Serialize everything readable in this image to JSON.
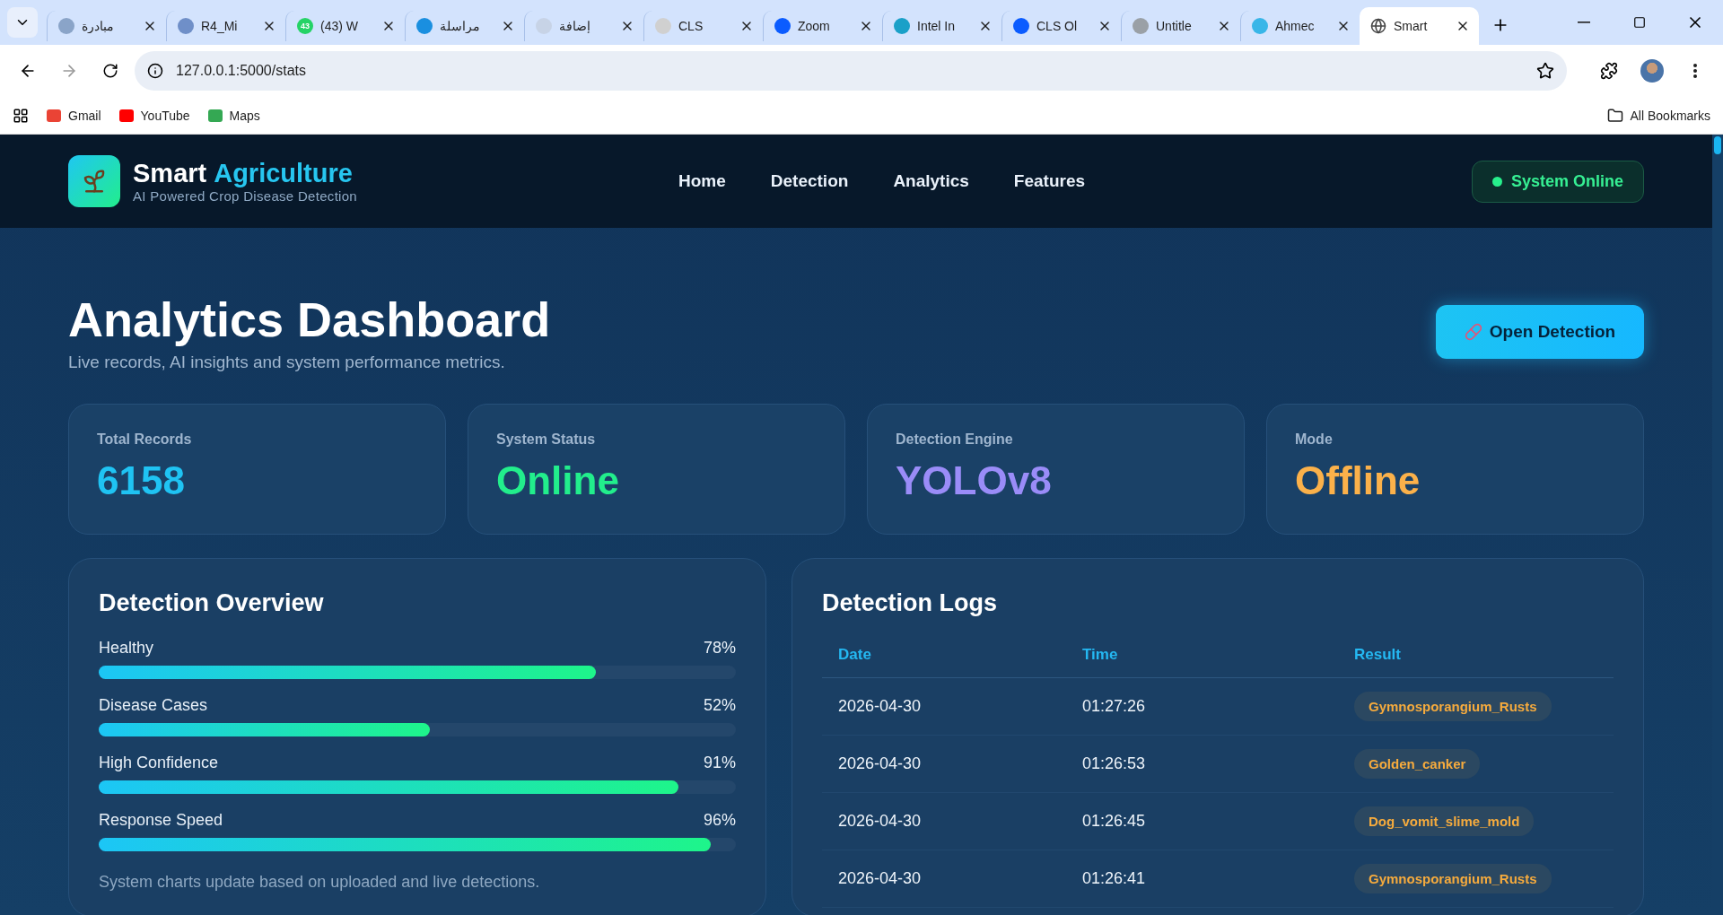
{
  "browser": {
    "tabs": [
      {
        "title": "مبادرة",
        "selected": false
      },
      {
        "title": "R4_Mi",
        "selected": false
      },
      {
        "title": "(43) W",
        "badge": "43",
        "selected": false
      },
      {
        "title": "مراسلة",
        "selected": false
      },
      {
        "title": "إضافة",
        "selected": false
      },
      {
        "title": "CLS",
        "selected": false
      },
      {
        "title": "Zoom",
        "selected": false
      },
      {
        "title": "Intel In",
        "selected": false
      },
      {
        "title": "CLS Ol",
        "selected": false
      },
      {
        "title": "Untitle",
        "selected": false
      },
      {
        "title": "Ahmec",
        "selected": false
      },
      {
        "title": "Smart",
        "selected": true
      }
    ],
    "address": "127.0.0.1:5000/stats",
    "bookmarks": [
      "Gmail",
      "YouTube",
      "Maps"
    ],
    "all_bookmarks": "All Bookmarks"
  },
  "header": {
    "brand": "Smart",
    "brand_accent": "Agriculture",
    "tagline": "AI Powered Crop Disease Detection",
    "nav": [
      "Home",
      "Detection",
      "Analytics",
      "Features"
    ],
    "status": "System Online"
  },
  "heading": "Analytics Dashboard",
  "subtitle": "Live records, AI insights and system performance metrics.",
  "action_button": "Open Detection",
  "stats": [
    {
      "label": "Total Records",
      "value": "6158",
      "color": "#1fc3f3"
    },
    {
      "label": "System Status",
      "value": "Online",
      "color": "#22ee8c"
    },
    {
      "label": "Detection Engine",
      "value": "YOLOv8",
      "color": "#9a8cf8"
    },
    {
      "label": "Mode",
      "value": "Offline",
      "color": "#fbb14a"
    }
  ],
  "overview": {
    "title": "Detection Overview",
    "bars": [
      {
        "label": "Healthy",
        "reading": "78%",
        "level": 0.78
      },
      {
        "label": "Disease Cases",
        "reading": "52%",
        "level": 0.52
      },
      {
        "label": "High Confidence",
        "reading": "91%",
        "level": 0.91
      },
      {
        "label": "Response Speed",
        "reading": "96%",
        "level": 0.96
      }
    ],
    "note": "System charts update based on uploaded and live detections."
  },
  "logs": {
    "title": "Detection Logs",
    "columns": [
      "Date",
      "Time",
      "Result"
    ],
    "rows": [
      {
        "date": "2026-04-30",
        "time": "01:27:26",
        "result": "Gymnosporangium_Rusts"
      },
      {
        "date": "2026-04-30",
        "time": "01:26:53",
        "result": "Golden_canker"
      },
      {
        "date": "2026-04-30",
        "time": "01:26:45",
        "result": "Dog_vomit_slime_mold"
      },
      {
        "date": "2026-04-30",
        "time": "01:26:41",
        "result": "Gymnosporangium_Rusts"
      }
    ]
  }
}
